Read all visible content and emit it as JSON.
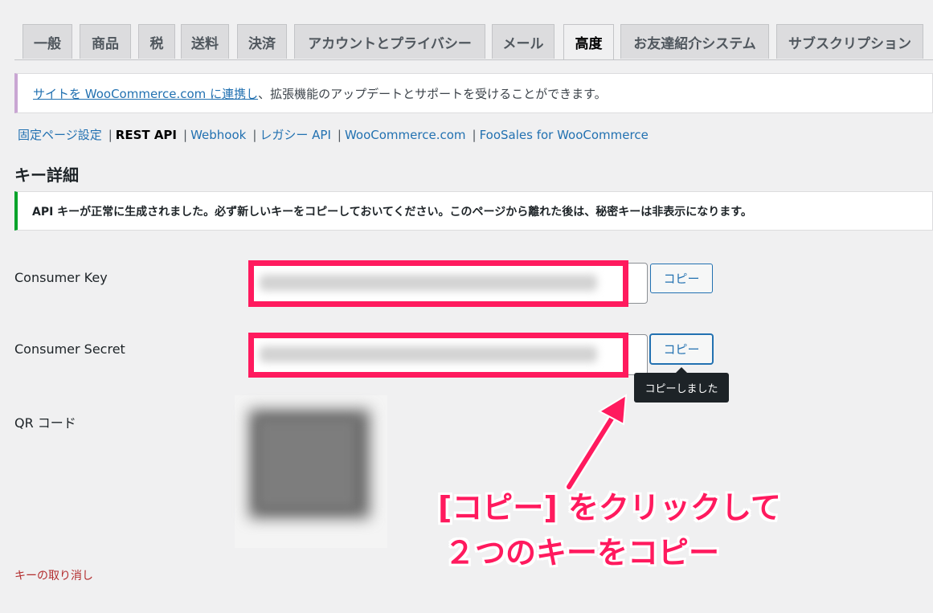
{
  "tabs": [
    {
      "label": "一般"
    },
    {
      "label": "商品"
    },
    {
      "label": "税"
    },
    {
      "label": "送料"
    },
    {
      "label": "決済"
    },
    {
      "label": "アカウントとプライバシー"
    },
    {
      "label": "メール"
    },
    {
      "label": "高度",
      "active": true
    },
    {
      "label": "お友達紹介システム"
    },
    {
      "label": "サブスクリプション"
    }
  ],
  "connect_notice": {
    "link": "サイトを WooCommerce.com に連携し",
    "text": "、拡張機能のアップデートとサポートを受けることができます。"
  },
  "subnav": [
    {
      "label": "固定ページ設定"
    },
    {
      "label": "REST API",
      "current": true
    },
    {
      "label": "Webhook"
    },
    {
      "label": "レガシー API"
    },
    {
      "label": "WooCommerce.com"
    },
    {
      "label": "FooSales for WooCommerce"
    }
  ],
  "subnav_separator": "|",
  "section_title": "キー詳細",
  "success_notice": "API キーが正常に生成されました。必ず新しいキーをコピーしておいてください。このページから離れた後は、秘密キーは非表示になります。",
  "consumer_key": {
    "label": "Consumer Key",
    "button": "コピー"
  },
  "consumer_secret": {
    "label": "Consumer Secret",
    "button": "コピー"
  },
  "tooltip": "コピーしました",
  "qr_label": "QR コード",
  "revoke_link": "キーの取り消し",
  "annotation": {
    "line1": "[コピー] をクリックして",
    "line2": "２つのキーをコピー",
    "color": "#ff1a5e"
  },
  "colors": {
    "link": "#2271b1",
    "success": "#00a32a",
    "danger": "#b32d2e",
    "highlight": "#ff1a5e"
  }
}
